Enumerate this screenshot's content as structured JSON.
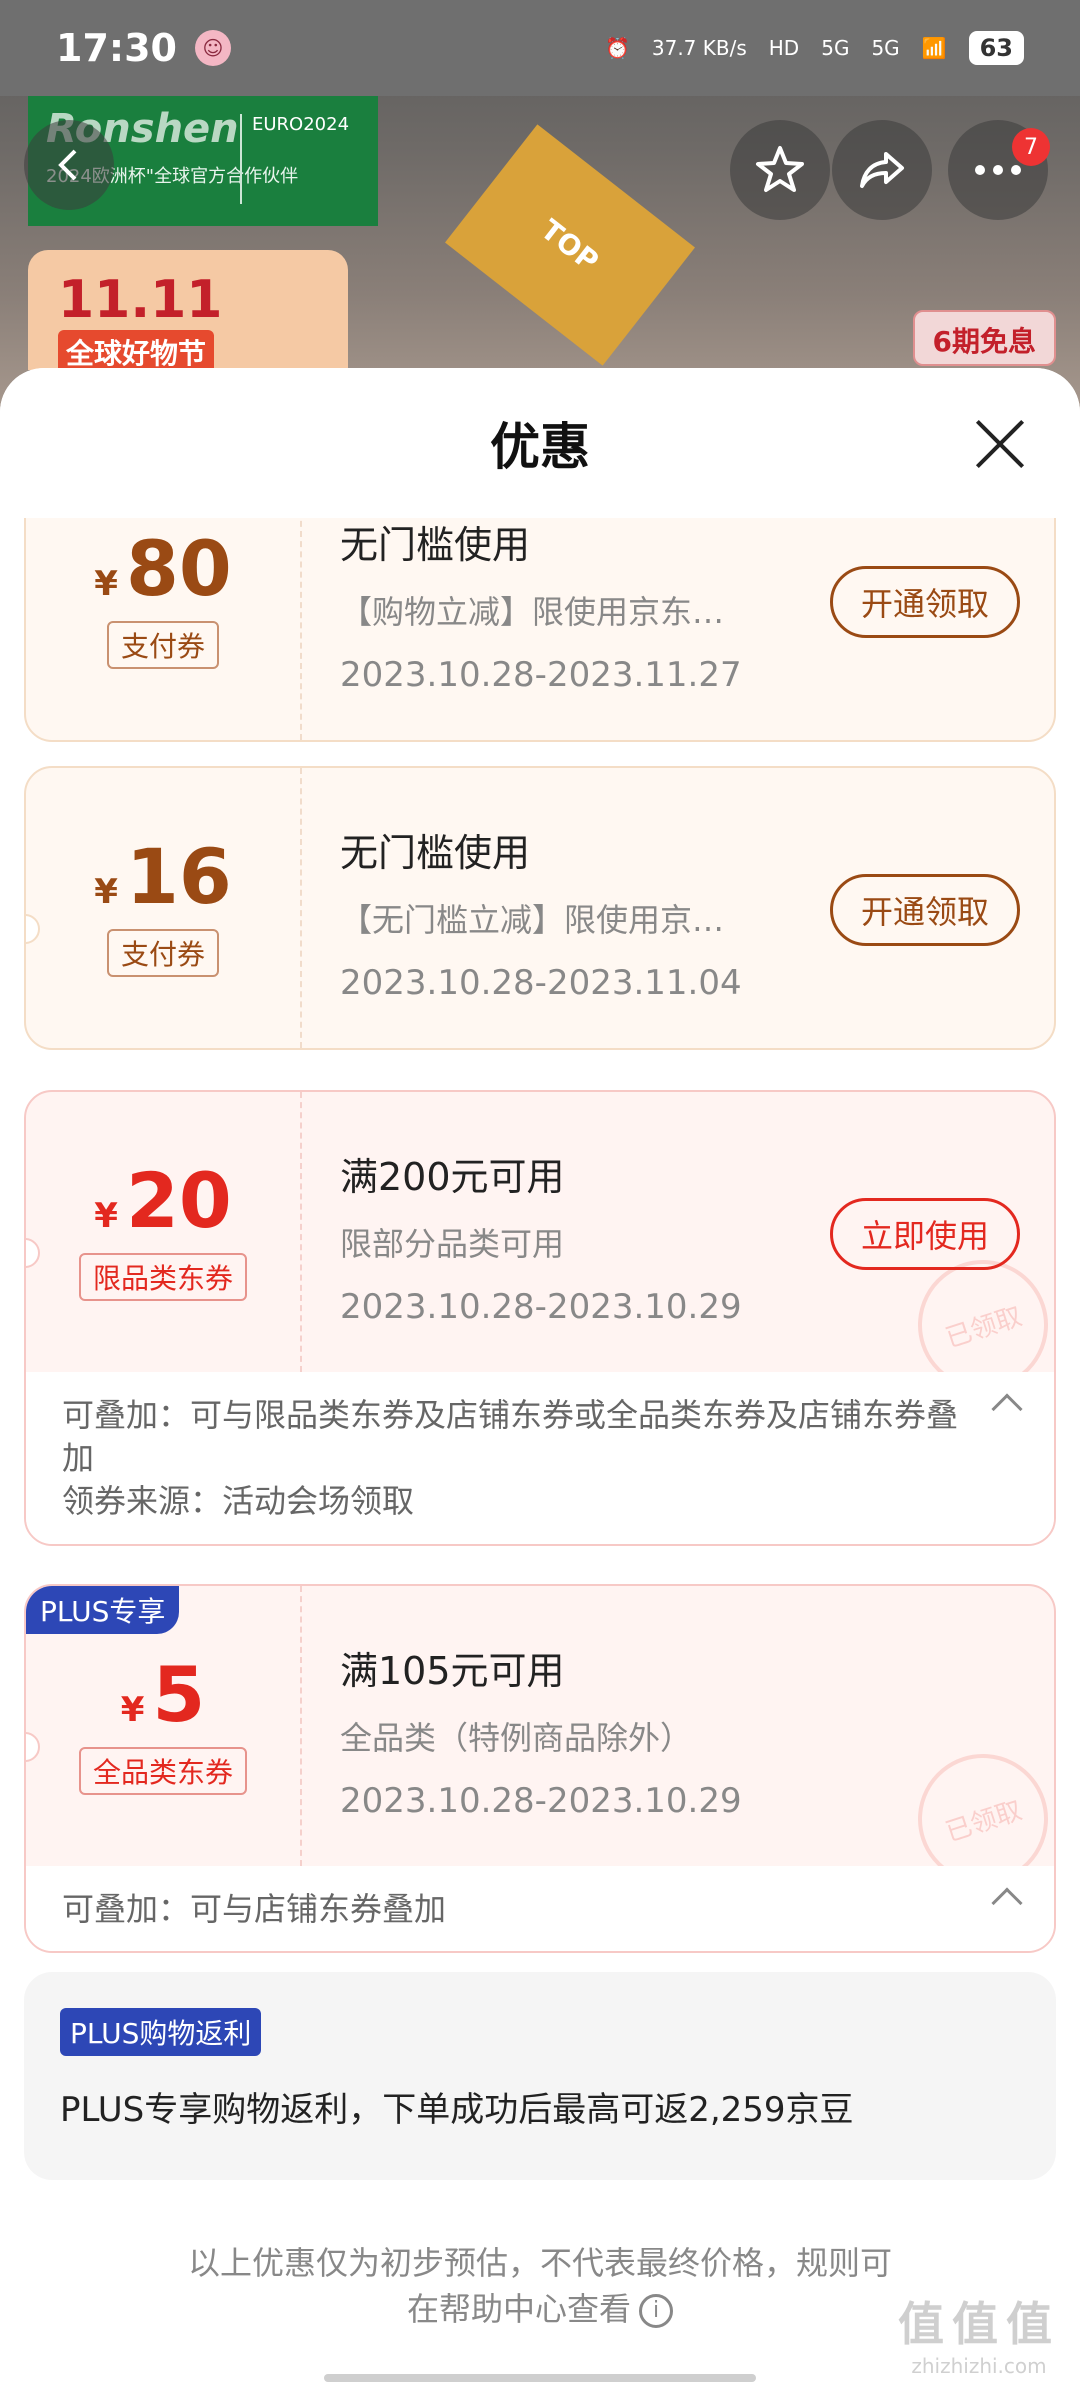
{
  "status_bar": {
    "time": "17:30",
    "network_speed": "37.7 KB/s",
    "signal1": "5G",
    "signal2": "5G",
    "hd": "HD",
    "battery": "63"
  },
  "background": {
    "brand": "Ronshen",
    "brand_sub": "2024欧洲杯\"全球官方合作伙伴",
    "euro": "EURO2024",
    "top_tag": "TOP",
    "promo_big": "11.11",
    "promo_small": "全球好物节",
    "six_badge": "6期免息",
    "notification_count": "7"
  },
  "sheet": {
    "title": "优惠"
  },
  "coupons": [
    {
      "currency": "¥",
      "amount": "80",
      "type": "支付券",
      "condition": "无门槛使用",
      "desc": "【购物立减】限使用京东…",
      "date": "2023.10.28-2023.11.27",
      "action": "开通领取"
    },
    {
      "currency": "¥",
      "amount": "16",
      "type": "支付券",
      "condition": "无门槛使用",
      "desc": "【无门槛立减】限使用京…",
      "date": "2023.10.28-2023.11.04",
      "action": "开通领取"
    },
    {
      "currency": "¥",
      "amount": "20",
      "type": "限品类东券",
      "condition": "满200元可用",
      "desc": "限部分品类可用",
      "date": "2023.10.28-2023.10.29",
      "action": "立即使用",
      "stamp": "已领取",
      "extra_line1": "可叠加：可与限品类东券及店铺东券或全品类东券及店铺东券叠加",
      "extra_line2": "领券来源：活动会场领取"
    },
    {
      "plus_tag": "PLUS专享",
      "currency": "¥",
      "amount": "5",
      "type": "全品类东券",
      "condition": "满105元可用",
      "desc": "全品类（特例商品除外）",
      "date": "2023.10.28-2023.10.29",
      "stamp": "已领取",
      "extra_line1": "可叠加：可与店铺东券叠加"
    }
  ],
  "rebate": {
    "tag": "PLUS购物返利",
    "text": "PLUS专享购物返利，下单成功后最高可返2,259京豆"
  },
  "footnote": {
    "line1": "以上优惠仅为初步预估，不代表最终价格，规则可",
    "line2": "在帮助中心查看"
  },
  "watermark": {
    "big": "值值值",
    "small": "zhizhizhi.com"
  }
}
